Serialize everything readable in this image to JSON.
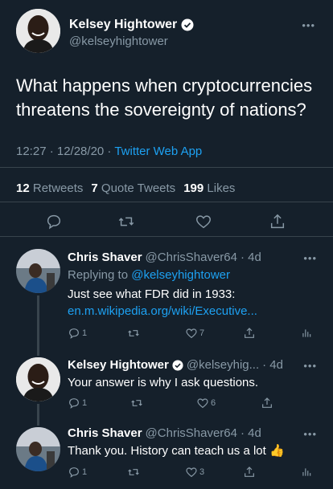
{
  "colors": {
    "background": "#15202b",
    "text": "#ffffff",
    "muted": "#8899a6",
    "link": "#1da1f2",
    "divider": "#38444d"
  },
  "main_tweet": {
    "author_name": "Kelsey Hightower",
    "author_handle": "@kelseyhightower",
    "text": "What happens when cryptocurrencies threatens the sovereignty of nations?",
    "time": "12:27 · 12/28/20 · ",
    "source": "Twitter Web App",
    "stats": {
      "retweets_count": "12",
      "retweets_label": "Retweets",
      "quotes_count": "7",
      "quotes_label": "Quote Tweets",
      "likes_count": "199",
      "likes_label": "Likes"
    },
    "icons": [
      "reply-icon",
      "retweet-icon",
      "like-icon",
      "share-icon"
    ]
  },
  "replies": [
    {
      "author_name": "Chris Shaver",
      "author_handle": "@ChrisShaver64",
      "age": "· 4d",
      "replying_to_label": "Replying to ",
      "replying_to_handle": "@kelseyhightower",
      "line1": "Just see what FDR did in 1933:",
      "link": "en.m.wikipedia.org/wiki/Executive...",
      "reply_count": "1",
      "retweet_count": "",
      "like_count": "7"
    },
    {
      "author_name": "Kelsey Hightower",
      "author_handle": "@kelseyhig...",
      "age": "· 4d",
      "text": "Your answer is why I ask questions.",
      "reply_count": "1",
      "retweet_count": "",
      "like_count": "6"
    },
    {
      "author_name": "Chris Shaver",
      "author_handle": "@ChrisShaver64",
      "age": "· 4d",
      "text": "Thank you. History can teach us a lot 👍",
      "reply_count": "1",
      "retweet_count": "",
      "like_count": "3"
    }
  ]
}
